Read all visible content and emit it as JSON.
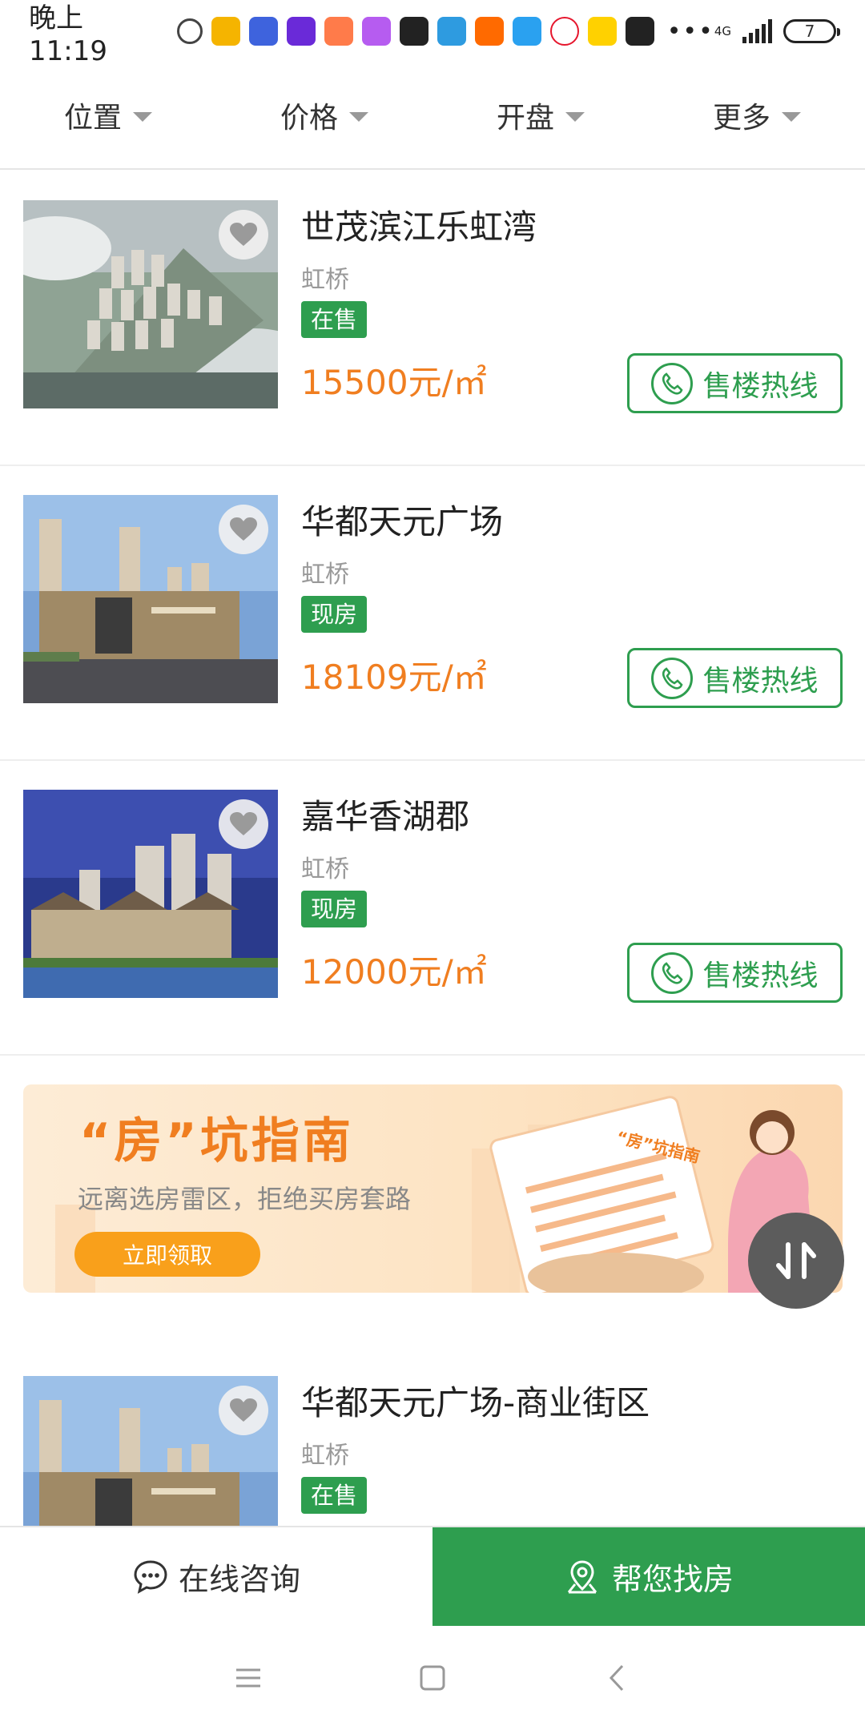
{
  "status_bar": {
    "time": "晚上11:19",
    "network": "4G",
    "battery": "7",
    "more": "•••",
    "notifications": [
      {
        "icon": "chat-bubble-icon",
        "color": "#ffffff"
      },
      {
        "icon": "app-yellow-icon",
        "color": "#f5b400"
      },
      {
        "icon": "tieba-icon",
        "color": "#3e63dd"
      },
      {
        "icon": "video-play-icon",
        "color": "#6a2ad8"
      },
      {
        "icon": "shopping-bag-icon",
        "color": "#ff7b4a"
      },
      {
        "icon": "message-purple-icon",
        "color": "#b65cf0"
      },
      {
        "icon": "soul-icon",
        "color": "#222222"
      },
      {
        "icon": "news-icon",
        "color": "#2e9be0"
      },
      {
        "icon": "mi-icon",
        "color": "#ff6a00"
      },
      {
        "icon": "note-blue-icon",
        "color": "#2aa1f0"
      },
      {
        "icon": "weibo-icon",
        "color": "#e6162d"
      },
      {
        "icon": "meituan-icon",
        "color": "#ffd100"
      },
      {
        "icon": "game-icon",
        "color": "#222222"
      }
    ]
  },
  "filters": [
    {
      "label": "位置"
    },
    {
      "label": "价格"
    },
    {
      "label": "开盘"
    },
    {
      "label": "更多"
    }
  ],
  "listings": [
    {
      "title": "世茂滨江乐虹湾",
      "area": "虹桥",
      "badge": "在售",
      "price": "15500元/㎡",
      "hotline_label": "售楼热线"
    },
    {
      "title": "华都天元广场",
      "area": "虹桥",
      "badge": "现房",
      "price": "18109元/㎡",
      "hotline_label": "售楼热线"
    },
    {
      "title": "嘉华香湖郡",
      "area": "虹桥",
      "badge": "现房",
      "price": "12000元/㎡",
      "hotline_label": "售楼热线"
    },
    {
      "title": "华都天元广场-商业街区",
      "area": "虹桥",
      "badge": "在售",
      "price": "",
      "hotline_label": ""
    }
  ],
  "banner": {
    "title": "“房”坑指南",
    "subtitle": "远离选房雷区，拒绝买房套路",
    "button": "立即领取",
    "paper_text": "“房”坑指南"
  },
  "actions": {
    "consult": "在线咨询",
    "find_home": "帮您找房"
  },
  "colors": {
    "brand_green": "#2e9e4f",
    "price_orange": "#f07e20",
    "banner_button": "#f9a01b"
  }
}
